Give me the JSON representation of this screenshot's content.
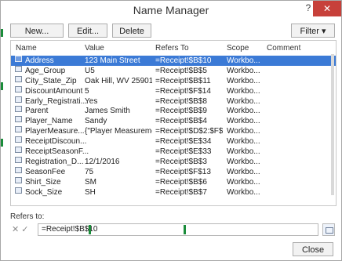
{
  "window": {
    "title": "Name Manager",
    "help_glyph": "?",
    "close_glyph": "✕"
  },
  "toolbar": {
    "new_label": "New...",
    "edit_label": "Edit...",
    "delete_label": "Delete",
    "filter_label": "Filter ▾"
  },
  "columns": {
    "name": "Name",
    "value": "Value",
    "refers_to": "Refers To",
    "scope": "Scope",
    "comment": "Comment"
  },
  "rows": [
    {
      "name": "Address",
      "value": "123 Main Street",
      "refers_to": "=Receipt!$B$10",
      "scope": "Workbo...",
      "comment": "",
      "selected": true
    },
    {
      "name": "Age_Group",
      "value": "U5",
      "refers_to": "=Receipt!$B$5",
      "scope": "Workbo...",
      "comment": "",
      "selected": false
    },
    {
      "name": "City_State_Zip",
      "value": "Oak Hill, WV 25901",
      "refers_to": "=Receipt!$B$11",
      "scope": "Workbo...",
      "comment": "",
      "selected": false
    },
    {
      "name": "DiscountAmount",
      "value": "5",
      "refers_to": "=Receipt!$F$14",
      "scope": "Workbo...",
      "comment": "",
      "selected": false
    },
    {
      "name": "Early_Registrati...",
      "value": "Yes",
      "refers_to": "=Receipt!$B$8",
      "scope": "Workbo...",
      "comment": "",
      "selected": false
    },
    {
      "name": "Parent",
      "value": "James Smith",
      "refers_to": "=Receipt!$B$9",
      "scope": "Workbo...",
      "comment": "",
      "selected": false
    },
    {
      "name": "Player_Name",
      "value": "Sandy",
      "refers_to": "=Receipt!$B$4",
      "scope": "Workbo...",
      "comment": "",
      "selected": false
    },
    {
      "name": "PlayerMeasure...",
      "value": "{\"Player Measureme",
      "refers_to": "=Receipt!$D$2:$F$10",
      "scope": "Workbo...",
      "comment": "",
      "selected": false
    },
    {
      "name": "ReceiptDiscoun...",
      "value": "",
      "refers_to": "=Receipt!$E$34",
      "scope": "Workbo...",
      "comment": "",
      "selected": false
    },
    {
      "name": "ReceiptSeasonF...",
      "value": "",
      "refers_to": "=Receipt!$E$33",
      "scope": "Workbo...",
      "comment": "",
      "selected": false
    },
    {
      "name": "Registration_D...",
      "value": "12/1/2016",
      "refers_to": "=Receipt!$B$3",
      "scope": "Workbo...",
      "comment": "",
      "selected": false
    },
    {
      "name": "SeasonFee",
      "value": "75",
      "refers_to": "=Receipt!$F$13",
      "scope": "Workbo...",
      "comment": "",
      "selected": false
    },
    {
      "name": "Shirt_Size",
      "value": "SM",
      "refers_to": "=Receipt!$B$6",
      "scope": "Workbo...",
      "comment": "",
      "selected": false
    },
    {
      "name": "Sock_Size",
      "value": "SH",
      "refers_to": "=Receipt!$B$7",
      "scope": "Workbo...",
      "comment": "",
      "selected": false
    }
  ],
  "refers": {
    "label": "Refers to:",
    "value": "=Receipt!$B$10",
    "cancel_glyph": "✕",
    "confirm_glyph": "✓"
  },
  "footer": {
    "close_label": "Close"
  }
}
